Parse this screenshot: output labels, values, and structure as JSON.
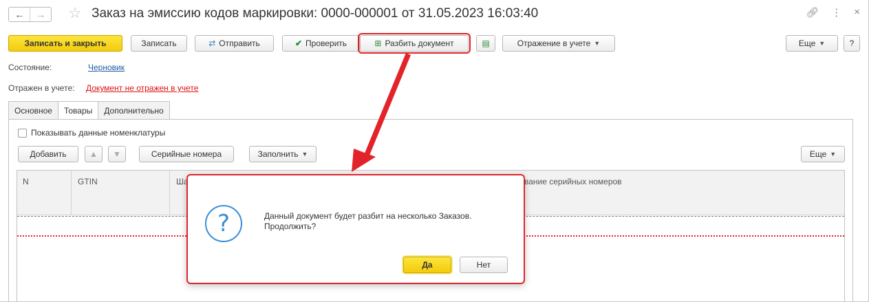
{
  "window": {
    "title": "Заказ на эмиссию кодов маркировки: 0000-000001 от 31.05.2023 16:03:40",
    "back_icon": "arrow-left",
    "forward_icon": "arrow-right",
    "star_icon": "star-outline",
    "link_icon": "link",
    "menu_icon": "more-vertical",
    "close_icon": "close"
  },
  "toolbar": {
    "save_close": "Записать и закрыть",
    "save": "Записать",
    "send": "Отправить",
    "check": "Проверить",
    "split": "Разбить документ",
    "reflection": "Отражение в учете",
    "more": "Еще",
    "help": "?"
  },
  "status": {
    "state_label": "Состояние:",
    "state_value": "Черновик",
    "accounting_label": "Отражен в учете:",
    "accounting_value": "Документ не отражен в учете"
  },
  "tabs": [
    "Основное",
    "Товары",
    "Дополнительно"
  ],
  "goods": {
    "show_nomenclature": "Показывать данные номенклатуры",
    "add": "Добавить",
    "serials": "Серийные номера",
    "fill": "Заполнить",
    "more": "Еще",
    "columns": [
      "N",
      "GTIN",
      "Ша",
      "вание серийных номеров"
    ]
  },
  "dialog": {
    "message_line1": "Данный документ будет разбит на несколько Заказов.",
    "message_line2": "Продолжить?",
    "yes": "Да",
    "no": "Нет"
  },
  "colors": {
    "accent_yellow": "#f3cb0c",
    "highlight_red": "#e3232a",
    "link_blue": "#1f5ba6",
    "icon_blue": "#3b8ed4"
  }
}
